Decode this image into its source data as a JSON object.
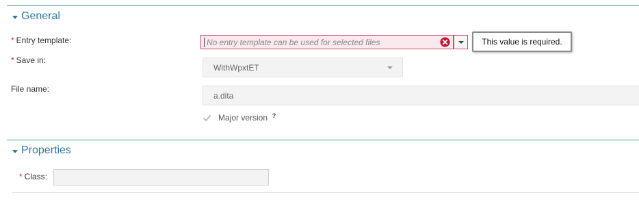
{
  "general": {
    "title": "General",
    "entry_template": {
      "label": "Entry template:",
      "required_mark": "*",
      "placeholder": "No entry template can be used for selected files",
      "error_tooltip": "This value is required."
    },
    "save_in": {
      "label": "Save in:",
      "required_mark": "*",
      "value": "WithWpxtET"
    },
    "file_name": {
      "label": "File name:",
      "value": "a.dita"
    },
    "major_version": {
      "label": "Major version",
      "checked": true,
      "help": "?"
    }
  },
  "properties": {
    "title": "Properties",
    "class": {
      "label": "Class:",
      "required_mark": "*",
      "value": ""
    }
  },
  "colors": {
    "accent": "#2b7aa6",
    "error_border": "#d24a6b",
    "error_bg": "#fbe9ee",
    "required": "#c0392b"
  }
}
